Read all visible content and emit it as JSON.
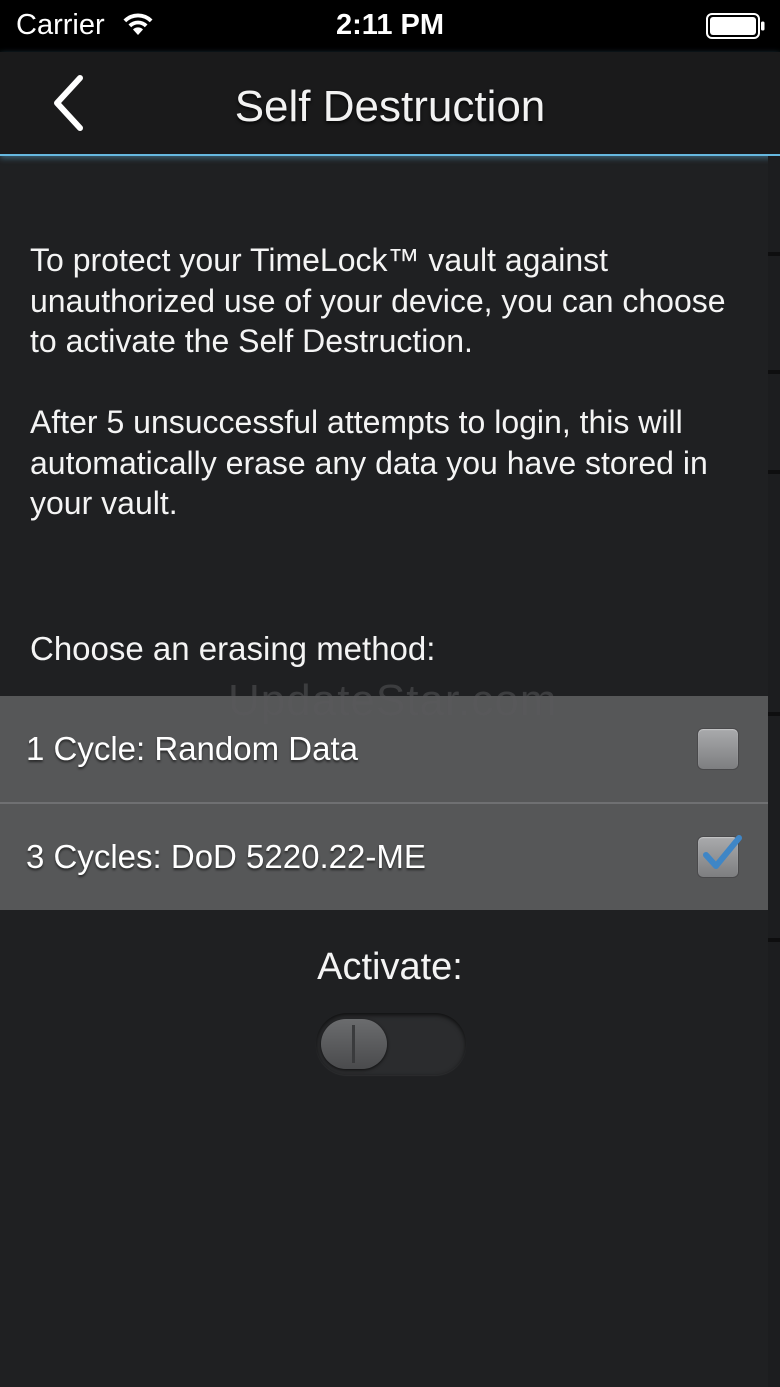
{
  "status_bar": {
    "carrier": "Carrier",
    "time": "2:11 PM",
    "wifi_icon": "wifi-icon",
    "battery_icon": "battery-full-icon"
  },
  "nav": {
    "back_icon": "chevron-left-icon",
    "title": "Self Destruction",
    "accent_color": "#66b8df"
  },
  "description": {
    "paragraph_1": "To protect your TimeLock™ vault against unauthorized use of your device, you can choose to activate the Self Destruction.",
    "paragraph_2": "After 5 unsuccessful attempts to login, this will automatically erase any data you have stored in your vault."
  },
  "erasing": {
    "heading": "Choose an erasing method:",
    "options": [
      {
        "label": "1 Cycle: Random Data",
        "checked": false
      },
      {
        "label": "3 Cycles: DoD 5220.22-ME",
        "checked": true
      }
    ],
    "check_color": "#3f86c6"
  },
  "activate": {
    "label": "Activate:",
    "enabled": false
  },
  "watermark": "UpdateStar.com"
}
